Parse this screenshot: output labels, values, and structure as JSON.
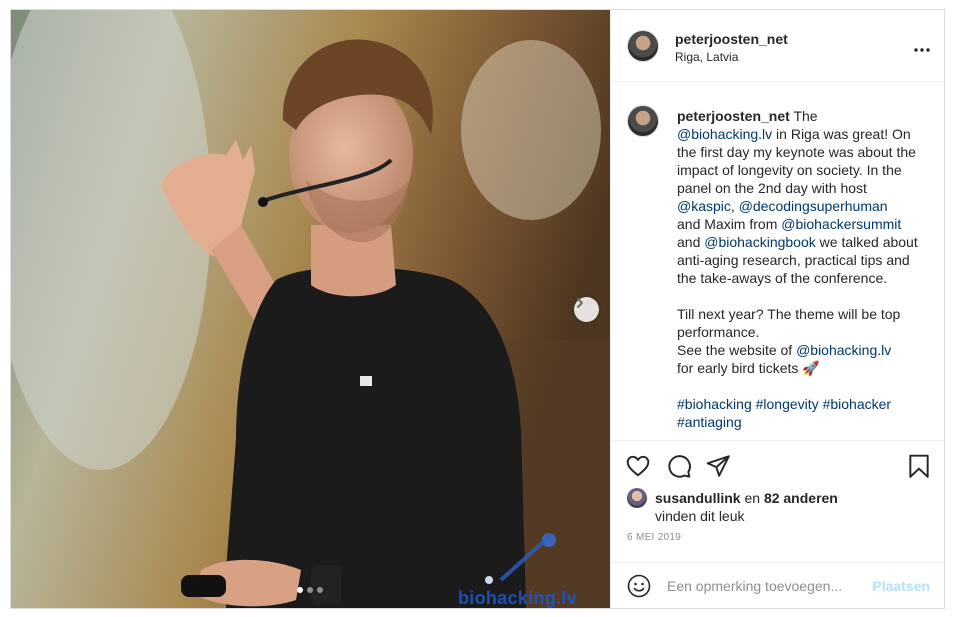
{
  "post": {
    "username": "peterjoosten_net",
    "location": "Riga, Latvia",
    "more_icon": "more-horizontal-icon",
    "watermark": "biohacking.lv",
    "carousel": {
      "slides": 3,
      "active": 1
    },
    "caption": {
      "username": "peterjoosten_net",
      "segments": [
        {
          "t": " The\n",
          "link": false
        },
        {
          "t": "@biohacking.lv",
          "link": true
        },
        {
          "t": " in Riga was great! On the first day my keynote was about the impact of longevity on society. In the panel on the 2nd day with host ",
          "link": false
        },
        {
          "t": "@kaspic",
          "link": true
        },
        {
          "t": ", ",
          "link": false
        },
        {
          "t": "@decodingsuperhuman",
          "link": true
        },
        {
          "t": "\nand Maxim from ",
          "link": false
        },
        {
          "t": "@biohackersummit",
          "link": true
        },
        {
          "t": "\nand ",
          "link": false
        },
        {
          "t": "@biohackingbook",
          "link": true
        },
        {
          "t": " we talked about anti-aging research, practical tips and the take-aways of the conference.\n\nTill next year? The theme will be top performance.\nSee the website of ",
          "link": false
        },
        {
          "t": "@biohacking.lv",
          "link": true
        },
        {
          "t": "\nfor early bird tickets 🚀\n\n",
          "link": false
        },
        {
          "t": "#biohacking",
          "link": true
        },
        {
          "t": " ",
          "link": false
        },
        {
          "t": "#longevity",
          "link": true
        },
        {
          "t": " ",
          "link": false
        },
        {
          "t": "#biohacker",
          "link": true
        },
        {
          "t": "\n",
          "link": false
        },
        {
          "t": "#antiaging",
          "link": true
        }
      ]
    },
    "likes": {
      "user": "susandullink",
      "connector": " en ",
      "others": "82 anderen",
      "suffix": "vinden dit leuk"
    },
    "date": "6 MEI 2019",
    "comment": {
      "placeholder": "Een opmerking toevoegen...",
      "post_label": "Plaatsen"
    },
    "icons": [
      "heart-icon",
      "comment-icon",
      "share-icon",
      "bookmark-icon",
      "emoji-icon",
      "chevron-right-icon"
    ],
    "colors": {
      "link": "#00376b",
      "muted": "#8e8e8e",
      "post_disabled": "#b2dffc",
      "border": "#dbdbdb"
    }
  }
}
